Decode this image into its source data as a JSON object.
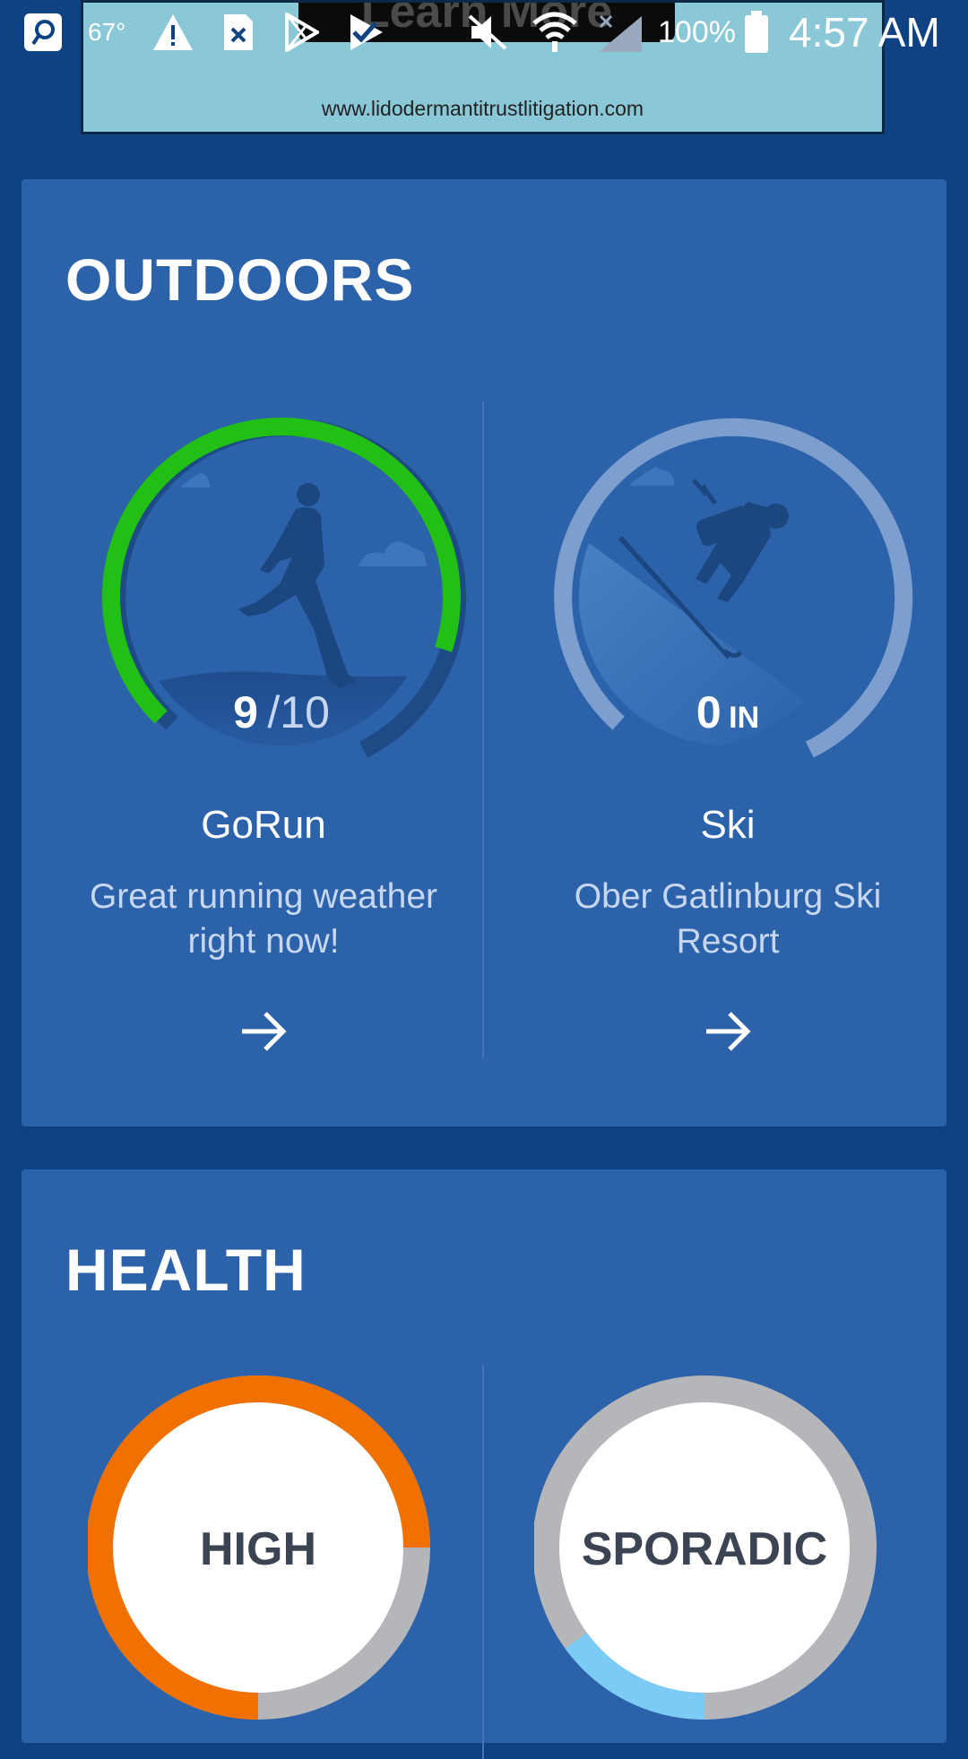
{
  "ad": {
    "headline": "Learn More",
    "url": "www.lidodermantitrustlitigation.com"
  },
  "status_bar": {
    "temperature": "67°",
    "battery": "100%",
    "time": "4:57 AM"
  },
  "outdoors": {
    "title": "OUTDOORS",
    "gorun": {
      "score": "9",
      "score_max": "/10",
      "score_value": 9,
      "name": "GoRun",
      "description": "Great running weather right now!",
      "icon": "runner-icon"
    },
    "ski": {
      "amount": "0",
      "unit": "IN",
      "name": "Ski",
      "description": "Ober Gatlinburg Ski Resort",
      "icon": "skier-icon"
    }
  },
  "health": {
    "title": "HEALTH",
    "left": {
      "label": "HIGH",
      "fill": 0.75,
      "color": "#f07000"
    },
    "right": {
      "label": "SPORADIC",
      "fill": 0.15,
      "color": "#7ccbf4"
    }
  },
  "colors": {
    "background": "#0f4283",
    "card": "#2b62aa",
    "gauge_green": "#22c014",
    "gauge_track": "#7d9fd0"
  }
}
